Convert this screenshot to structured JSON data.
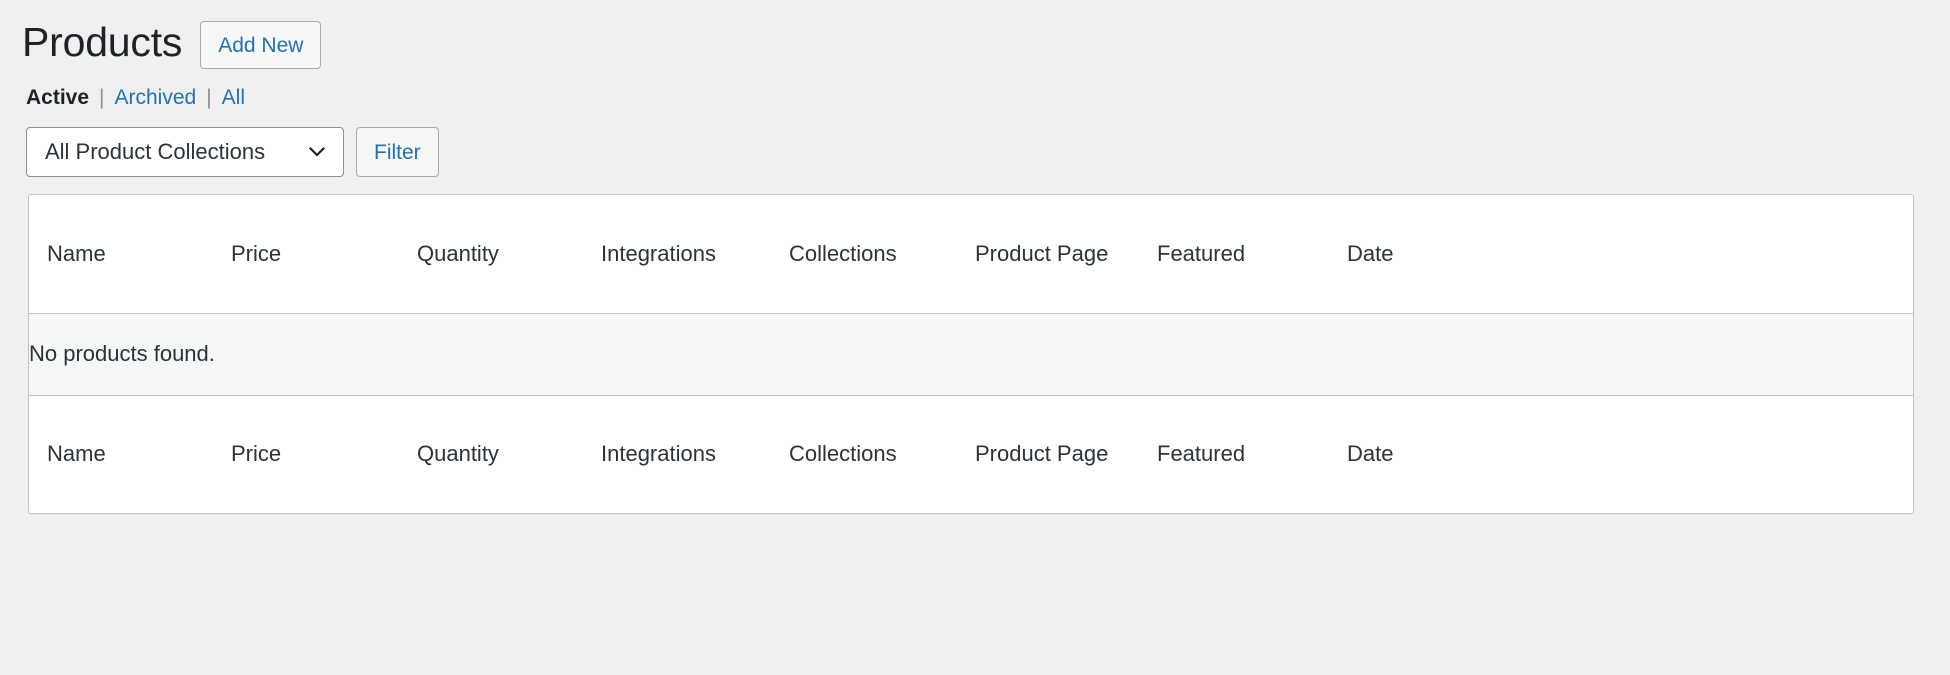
{
  "header": {
    "title": "Products",
    "add_new_label": "Add New"
  },
  "status_links": {
    "items": [
      {
        "label": "Active",
        "current": true
      },
      {
        "label": "Archived",
        "current": false
      },
      {
        "label": "All",
        "current": false
      }
    ],
    "separator": "|"
  },
  "filters": {
    "collection_select": {
      "selected": "All Product Collections",
      "options": [
        "All Product Collections"
      ],
      "icon": "chevron-down-icon"
    },
    "filter_button_label": "Filter"
  },
  "table": {
    "columns": [
      "Name",
      "Price",
      "Quantity",
      "Integrations",
      "Collections",
      "Product Page",
      "Featured",
      "Date"
    ],
    "rows": [],
    "empty_message": "No products found.",
    "footer_columns": [
      "Name",
      "Price",
      "Quantity",
      "Integrations",
      "Collections",
      "Product Page",
      "Featured",
      "Date"
    ]
  },
  "colors": {
    "page_background": "#f0f0f1",
    "link_blue": "#2271b1",
    "text_dark": "#1d2327",
    "text_body": "#2c3338",
    "border_gray": "#c3c4c7",
    "empty_row_background": "#f6f7f7"
  }
}
